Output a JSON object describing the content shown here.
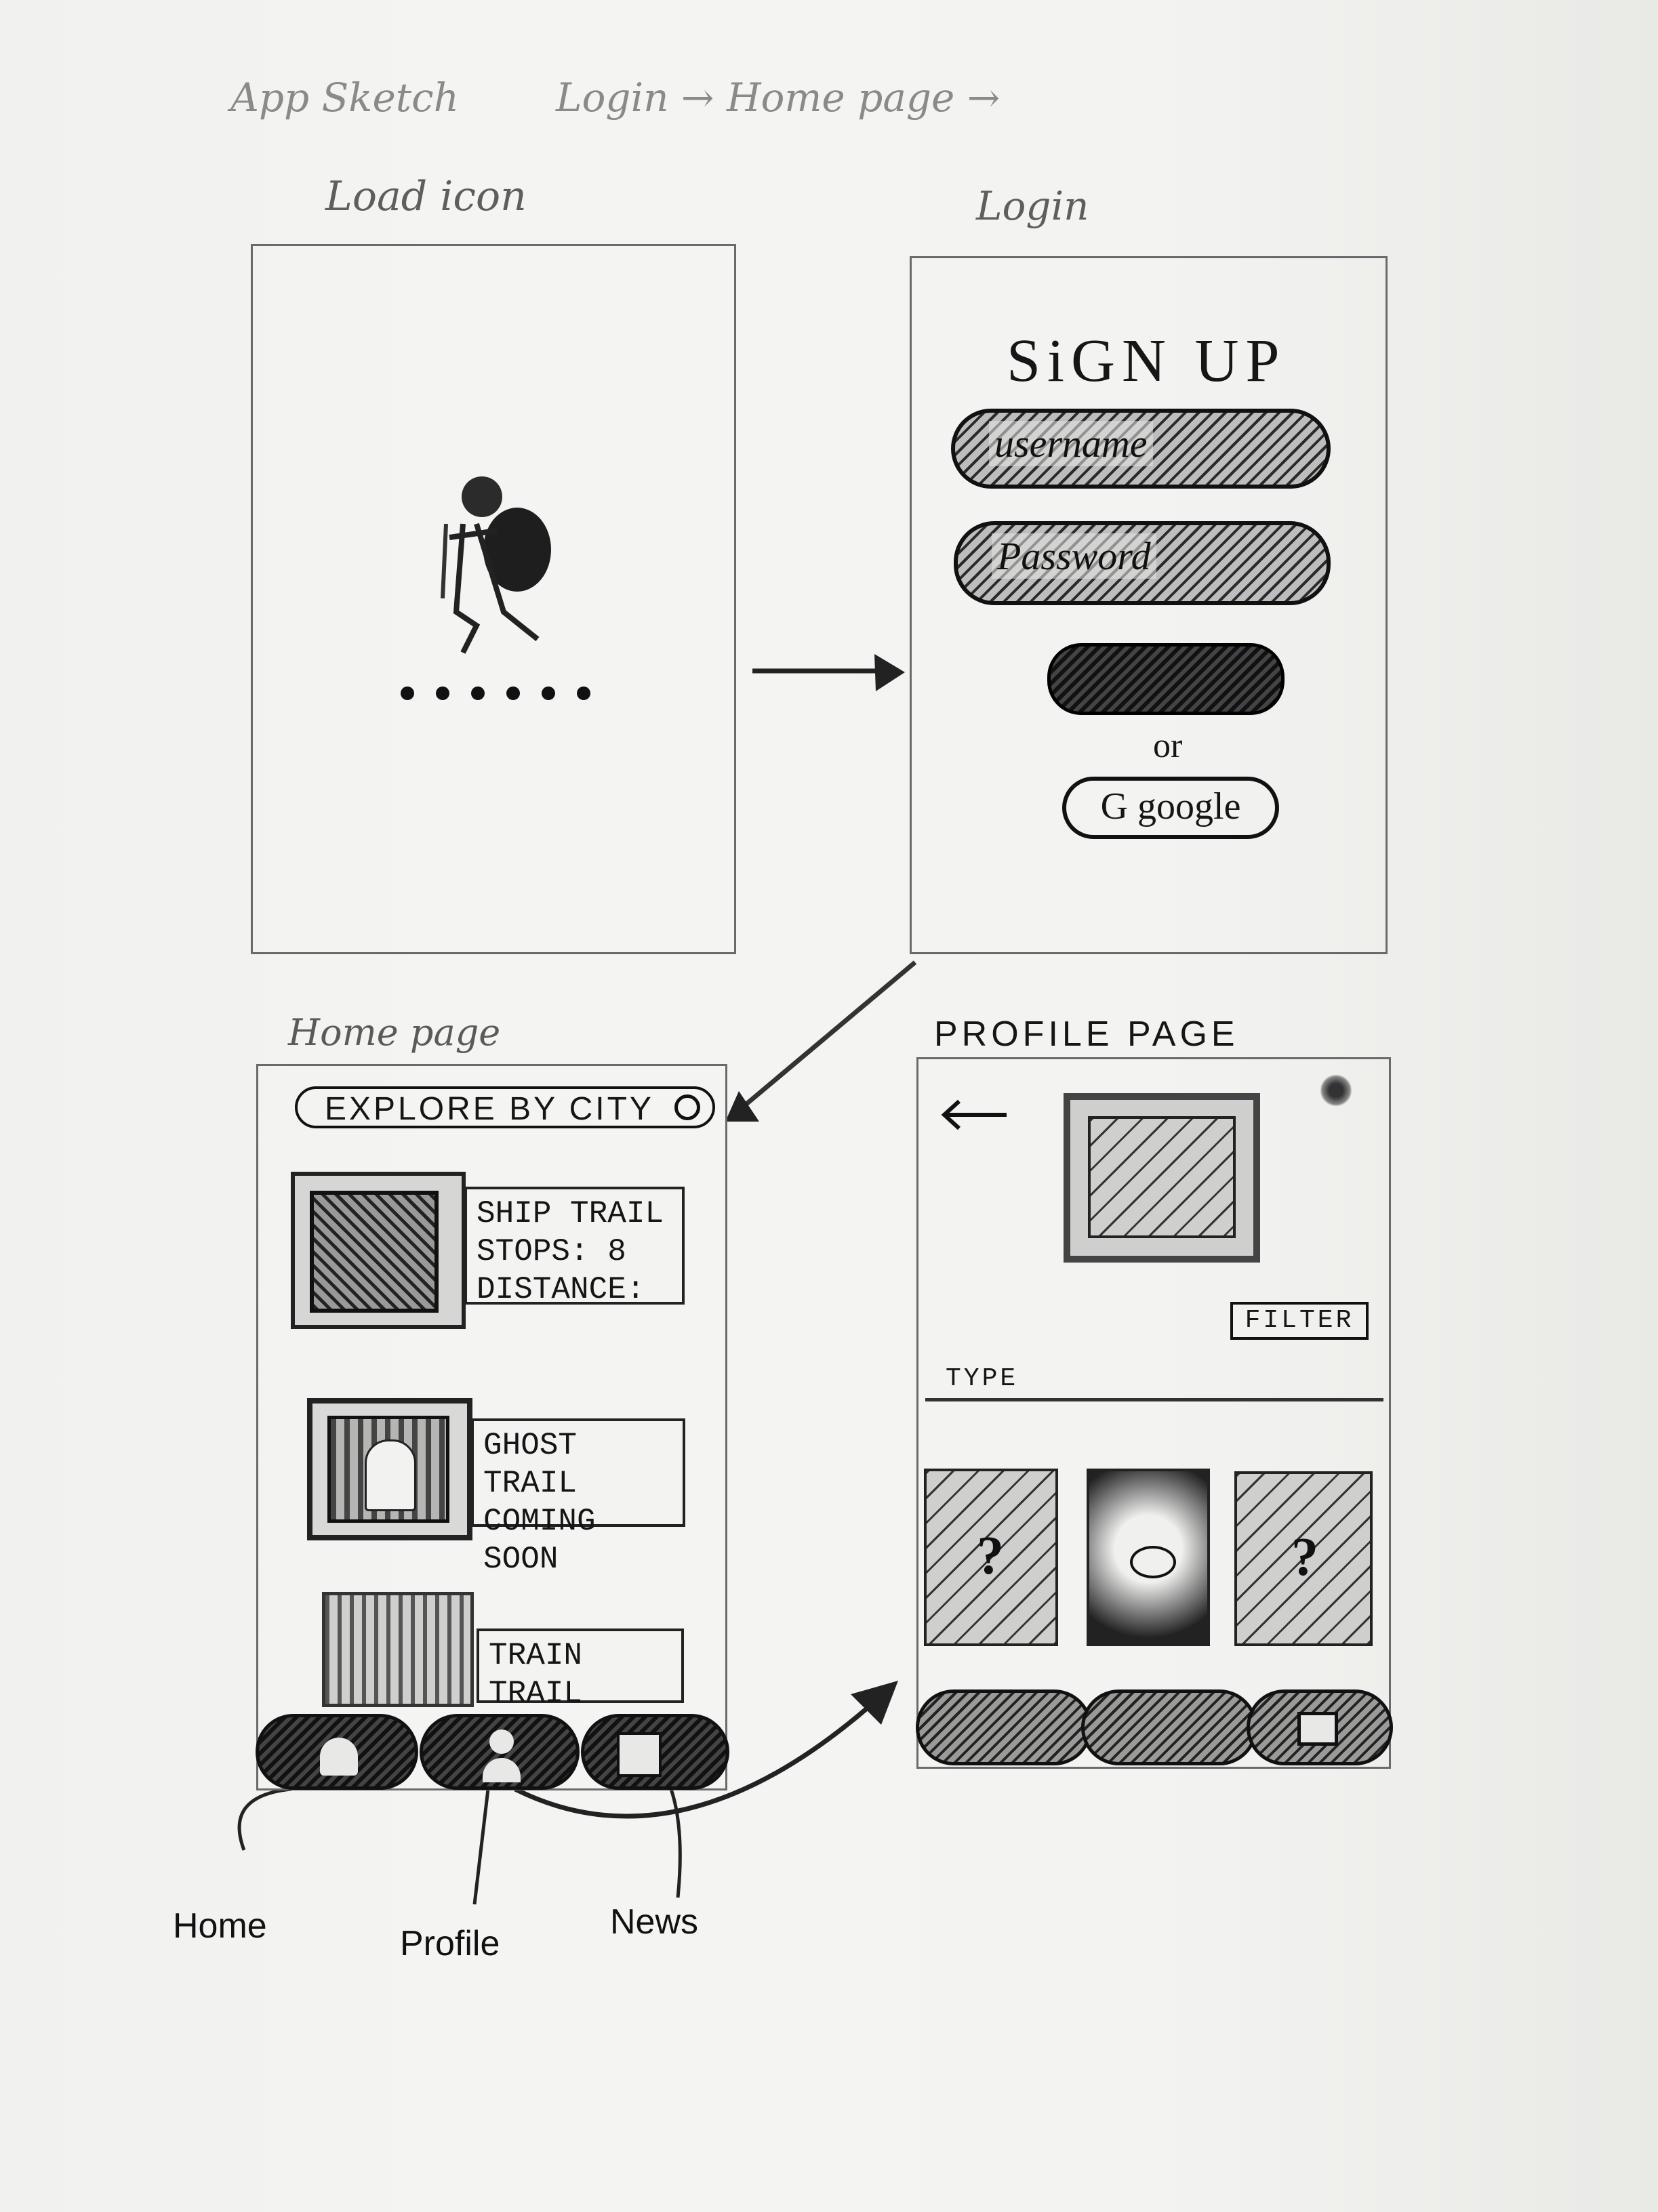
{
  "header": {
    "sketch_title": "App Sketch",
    "flow_title": "Login → Home page →"
  },
  "screens": {
    "load": {
      "label": "Load icon"
    },
    "login": {
      "label": "Login",
      "heading": "SiGN UP",
      "username_placeholder": "username",
      "password_placeholder": "Password",
      "or_text": "or",
      "google_button": "G google"
    },
    "home": {
      "label": "Home page",
      "search_label": "EXPLORE BY CITY",
      "cards": [
        {
          "title": "SHIP TRAIL",
          "line2": "STOPS: 8",
          "line3": "DISTANCE:"
        },
        {
          "title": "GHOST TRAIL",
          "line2": "COMING SOON",
          "line3": ""
        },
        {
          "title": "TRAIN TRAIL",
          "line2": "",
          "line3": ""
        }
      ]
    },
    "profile": {
      "label": "PROFILE PAGE",
      "filter_button": "FILTER",
      "type_label": "TYPE",
      "badges": [
        "?",
        "",
        "?"
      ]
    }
  },
  "nav_labels": {
    "home": "Home",
    "profile": "Profile",
    "news": "News"
  }
}
